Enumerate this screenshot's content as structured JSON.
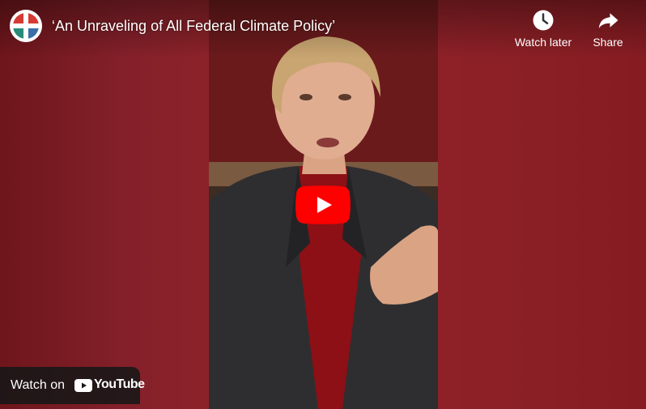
{
  "video": {
    "title": "‘An Unraveling of All Federal Climate Policy’"
  },
  "actions": {
    "watch_later_label": "Watch later",
    "share_label": "Share"
  },
  "footer": {
    "watch_on_label": "Watch on",
    "platform_label": "YouTube"
  },
  "icons": {
    "avatar": "channel-logo-icon",
    "watch_later": "clock-icon",
    "share": "share-arrow-icon",
    "play": "play-icon",
    "platform": "youtube-logo-icon"
  },
  "colors": {
    "background": "#8a1d24",
    "play_button": "#ff0000",
    "text": "#ffffff",
    "watch_on_bg": "#171717"
  }
}
